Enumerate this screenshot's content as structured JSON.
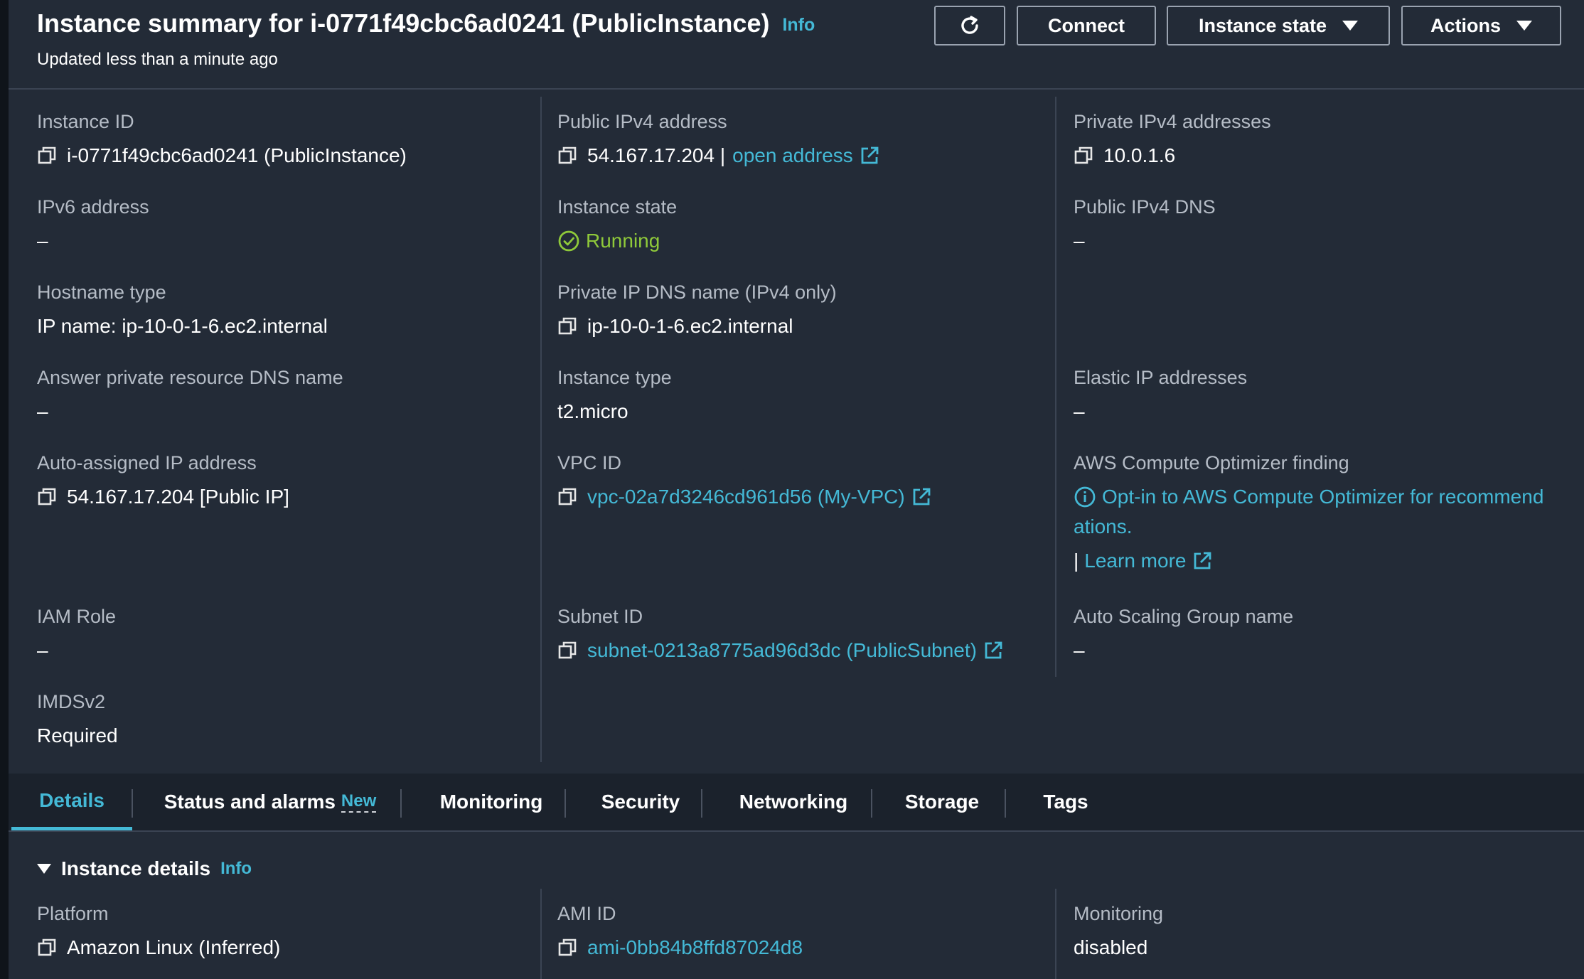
{
  "header": {
    "title": "Instance summary for i-0771f49cbc6ad0241 (PublicInstance)",
    "info": "Info",
    "subtitle": "Updated less than a minute ago",
    "buttons": {
      "refresh_icon": "refresh-icon",
      "connect": "Connect",
      "instance_state": "Instance state",
      "actions": "Actions"
    }
  },
  "summary": {
    "instance_id": {
      "label": "Instance ID",
      "value": "i-0771f49cbc6ad0241 (PublicInstance)"
    },
    "ipv6": {
      "label": "IPv6 address",
      "value": "–"
    },
    "hostname_type": {
      "label": "Hostname type",
      "value": "IP name: ip-10-0-1-6.ec2.internal"
    },
    "answer_dns": {
      "label": "Answer private resource DNS name",
      "value": "–"
    },
    "auto_ip": {
      "label": "Auto-assigned IP address",
      "value": "54.167.17.204 [Public IP]"
    },
    "iam_role": {
      "label": "IAM Role",
      "value": "–"
    },
    "imdsv2": {
      "label": "IMDSv2",
      "value": "Required"
    },
    "public_ipv4": {
      "label": "Public IPv4 address",
      "value": "54.167.17.204 |",
      "link": "open address"
    },
    "instance_state": {
      "label": "Instance state",
      "value": "Running",
      "color": "#8fc93a"
    },
    "private_dns": {
      "label": "Private IP DNS name (IPv4 only)",
      "value": "ip-10-0-1-6.ec2.internal"
    },
    "instance_type": {
      "label": "Instance type",
      "value": "t2.micro"
    },
    "vpc_id": {
      "label": "VPC ID",
      "value": "vpc-02a7d3246cd961d56 (My-VPC)"
    },
    "subnet_id": {
      "label": "Subnet ID",
      "value": "subnet-0213a8775ad96d3dc (PublicSubnet)"
    },
    "private_ipv4": {
      "label": "Private IPv4 addresses",
      "value": "10.0.1.6"
    },
    "public_dns": {
      "label": "Public IPv4 DNS",
      "value": "–"
    },
    "elastic_ip": {
      "label": "Elastic IP addresses",
      "value": "–"
    },
    "optimizer": {
      "label": "AWS Compute Optimizer finding",
      "line1": "Opt-in to AWS Compute Optimizer for recommend",
      "line2": "ations.",
      "sep": "|",
      "learn_more": "Learn more"
    },
    "asg": {
      "label": "Auto Scaling Group name",
      "value": "–"
    }
  },
  "tabs": [
    {
      "label": "Details",
      "active": true
    },
    {
      "label": "Status and alarms",
      "badge": "New"
    },
    {
      "label": "Monitoring"
    },
    {
      "label": "Security"
    },
    {
      "label": "Networking"
    },
    {
      "label": "Storage"
    },
    {
      "label": "Tags"
    }
  ],
  "details": {
    "title": "Instance details",
    "info": "Info",
    "platform": {
      "label": "Platform",
      "value": "Amazon Linux (Inferred)"
    },
    "ami_id": {
      "label": "AMI ID",
      "value": "ami-0bb84b8ffd87024d8"
    },
    "monitoring": {
      "label": "Monitoring",
      "value": "disabled"
    }
  },
  "colors": {
    "background": "#232b37",
    "accent_link": "#44b9d6",
    "running": "#8fc93a"
  }
}
